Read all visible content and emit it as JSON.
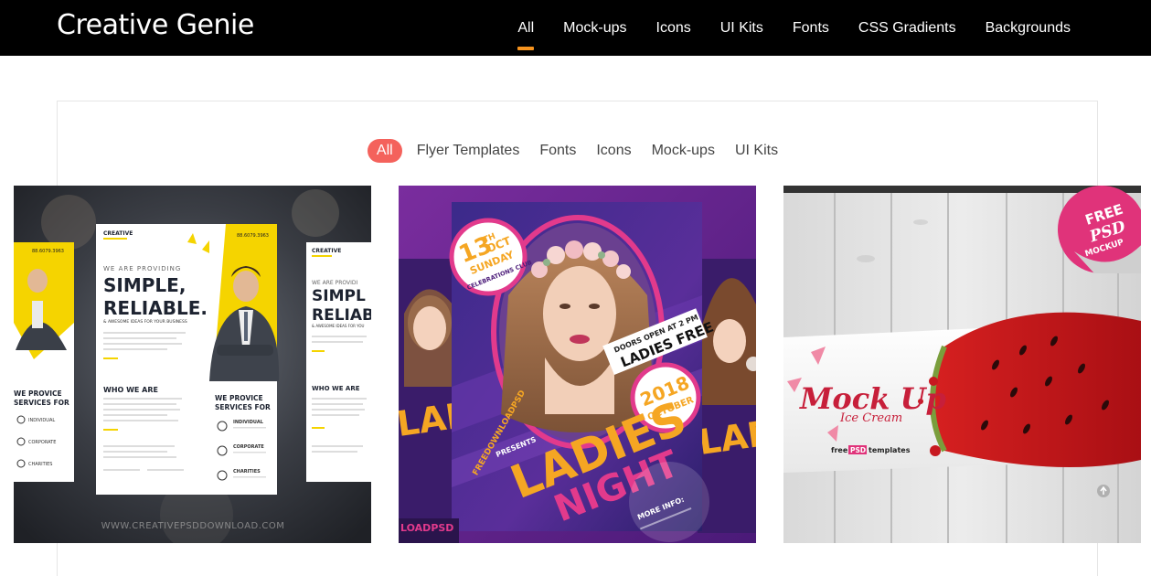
{
  "header": {
    "brand": "Creative Genie",
    "nav": [
      {
        "label": "All",
        "active": true
      },
      {
        "label": "Mock-ups"
      },
      {
        "label": "Icons"
      },
      {
        "label": "UI Kits"
      },
      {
        "label": "Fonts"
      },
      {
        "label": "CSS Gradients"
      },
      {
        "label": "Backgrounds"
      }
    ]
  },
  "filters": [
    {
      "label": "All",
      "active": true
    },
    {
      "label": "Flyer Templates"
    },
    {
      "label": "Fonts"
    },
    {
      "label": "Icons"
    },
    {
      "label": "Mock-ups"
    },
    {
      "label": "UI Kits"
    }
  ],
  "cards": {
    "flyer": {
      "logo": "CREATIVE",
      "phone": "88.6079.3963",
      "eyebrow": "WE ARE PROVIDING",
      "headline1": "SIMPLE,",
      "headline2": "RELIABLE.",
      "tagline": "& AWESOME IDEAS FOR YOUR BUSINESS",
      "who": "WHO WE ARE",
      "provide1": "WE PROVICE",
      "provide2": "SERVICES FOR",
      "svc1": "INDIVIDUAL",
      "svc2": "CORPORATE",
      "svc3": "CHARITIES",
      "watermark": "WWW.CREATIVEPSDDOWNLOAD.COM",
      "side_logo": "CREATIVE",
      "side_eyebrow": "WE ARE PROVIDI",
      "side_h1": "SIMPL",
      "side_h2": "RELIAB",
      "side_tag": "& AWESOME IDEAS FOR YOU",
      "side_who": "WHO WE ARE",
      "left_phone": "88.6079.3963",
      "left_provide1": "WE PROVICE",
      "left_provide2": "SERVICES FOR",
      "left_svc1": "INDIVIDUAL",
      "left_svc2": "CORPORATE",
      "left_svc3": "CHARITIES"
    },
    "party": {
      "day_num": "13",
      "day_suffix": "TH",
      "month": "OCT",
      "weekday": "SUNDAY",
      "club": "CELEBRATIONS CLUB",
      "doors": "DOORS OPEN AT 2 PM",
      "free": "LADIES FREE",
      "year": "2018",
      "month_full": "OCTOBER",
      "presenter": "FREEDOWNLOADPSD",
      "presents": "PRESENTS",
      "title1": "LADIES",
      "title2": "NIGHT",
      "more": "MORE INFO:",
      "brand": "LOADPSD"
    },
    "mockup": {
      "badge1": "FREE",
      "badge2": "PSD",
      "badge3": "MOCKUP",
      "title": "Mock Up",
      "subtitle": "Ice Cream",
      "brand_pre": "free",
      "brand_mid": "PSD",
      "brand_post": "templates"
    }
  }
}
